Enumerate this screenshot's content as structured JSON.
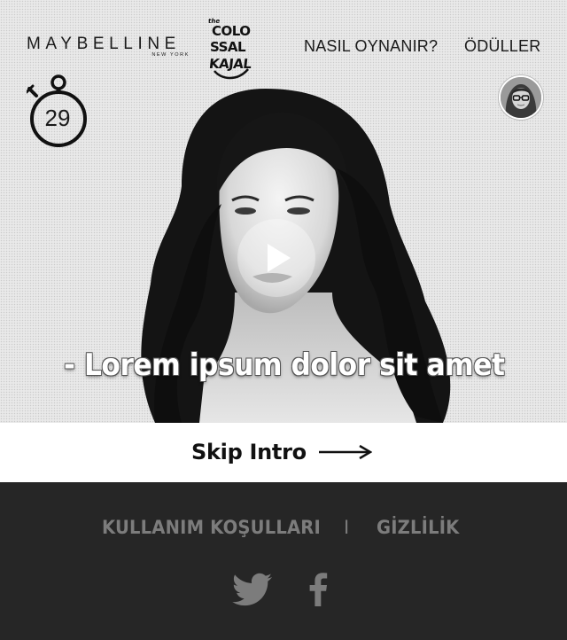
{
  "header": {
    "brand_name": "MAYBELLINE",
    "brand_sub": "NEW YORK",
    "campaign_lines": [
      "the",
      "COLO",
      "SSAL",
      "KAJAL"
    ],
    "nav": {
      "how_to_play": "NASIL OYNANIR?",
      "prizes": "ÖDÜLLER"
    }
  },
  "timer": {
    "value": "29",
    "icon": "stopwatch-icon"
  },
  "video": {
    "caption": "- Lorem ipsum dolor sit amet",
    "play_icon": "play-icon"
  },
  "skip": {
    "label": "Skip Intro",
    "icon": "arrow-right-icon"
  },
  "footer": {
    "terms": "KULLANIM KOŞULLARI",
    "separator": "I",
    "privacy": "GİZLİLİK",
    "social": [
      "twitter-icon",
      "facebook-icon"
    ]
  },
  "colors": {
    "footer_bg": "#262626",
    "footer_text": "#7c7c7c",
    "hero_bg": "#e9e9e9"
  }
}
